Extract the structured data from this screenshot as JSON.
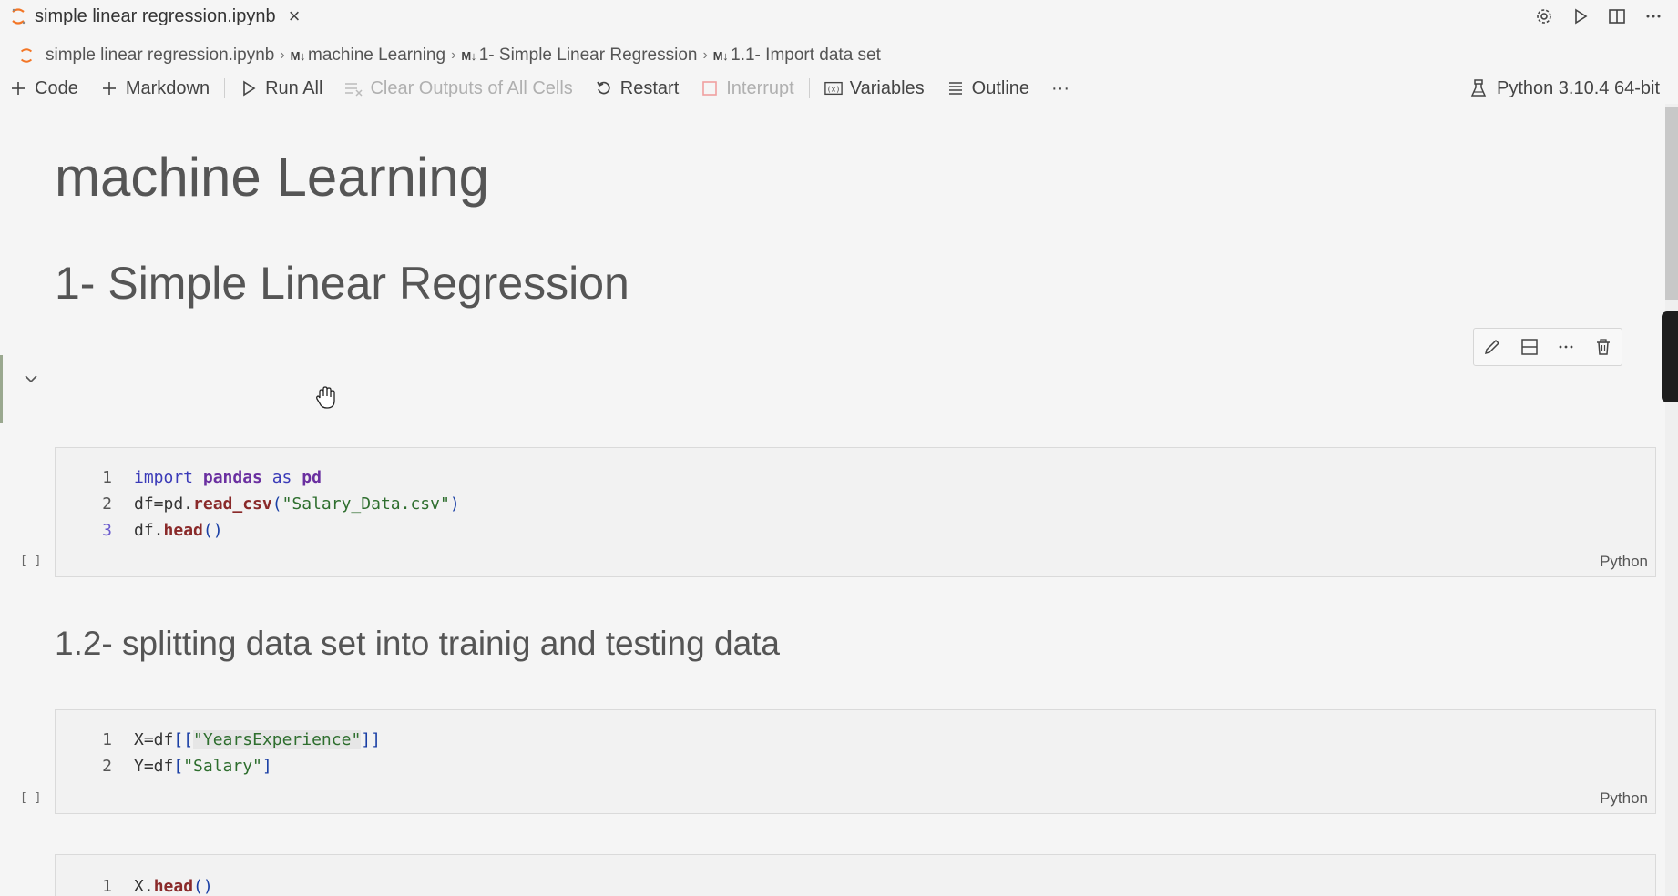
{
  "tab": {
    "title": "simple linear regression.ipynb",
    "close_icon": "×"
  },
  "editor_actions": [
    "settings-gear-icon",
    "run-icon",
    "split-editor-icon",
    "more-icon"
  ],
  "breadcrumb": {
    "file": "simple linear regression.ipynb",
    "items": [
      {
        "badge": "M↓",
        "label": "machine Learning"
      },
      {
        "badge": "M↓",
        "label": "1- Simple Linear Regression"
      },
      {
        "badge": "M↓",
        "label": "1.1- Import data set"
      }
    ]
  },
  "toolbar": {
    "code": "Code",
    "markdown": "Markdown",
    "run_all": "Run All",
    "clear_outputs": "Clear Outputs of All Cells",
    "restart": "Restart",
    "interrupt": "Interrupt",
    "variables": "Variables",
    "outline": "Outline",
    "more": "···"
  },
  "kernel": {
    "label": "Python 3.10.4 64-bit"
  },
  "cells": {
    "heading1": "machine Learning",
    "heading2": "1- Simple Linear Regression",
    "heading3": "1.2- splitting data set into trainig and testing data",
    "cell_toolbar": [
      "edit-icon",
      "split-cell-icon",
      "more-icon",
      "delete-icon"
    ],
    "exec_count": "[ ]",
    "language": "Python",
    "code1": [
      {
        "n": "1",
        "tokens": [
          [
            "kw",
            "import "
          ],
          [
            "kwb",
            "pandas "
          ],
          [
            "kw",
            "as "
          ],
          [
            "kwb",
            "pd"
          ]
        ]
      },
      {
        "n": "2",
        "tokens": [
          [
            "pl",
            "df=pd."
          ],
          [
            "fn",
            "read_csv"
          ],
          [
            "br",
            "("
          ],
          [
            "str",
            "\"Salary_Data.csv\""
          ],
          [
            "br",
            ")"
          ]
        ]
      },
      {
        "n": "3",
        "tokens": [
          [
            "pl",
            "df."
          ],
          [
            "fn",
            "head"
          ],
          [
            "br",
            "()"
          ]
        ]
      }
    ],
    "code2": [
      {
        "n": "1",
        "tokens": [
          [
            "pl",
            "X=df"
          ],
          [
            "br",
            "[["
          ],
          [
            "strbg",
            "\"YearsExperience\""
          ],
          [
            "br",
            "]]"
          ]
        ]
      },
      {
        "n": "2",
        "tokens": [
          [
            "pl",
            "Y=df"
          ],
          [
            "br",
            "["
          ],
          [
            "str",
            "\"Salary\""
          ],
          [
            "br",
            "]"
          ]
        ]
      }
    ],
    "code3": [
      {
        "n": "1",
        "tokens": [
          [
            "pl",
            "X."
          ],
          [
            "fn",
            "head"
          ],
          [
            "br",
            "()"
          ]
        ]
      }
    ]
  },
  "colors": {
    "focus_bar": "#9aa88f",
    "jupyter_orange": "#f37626"
  }
}
